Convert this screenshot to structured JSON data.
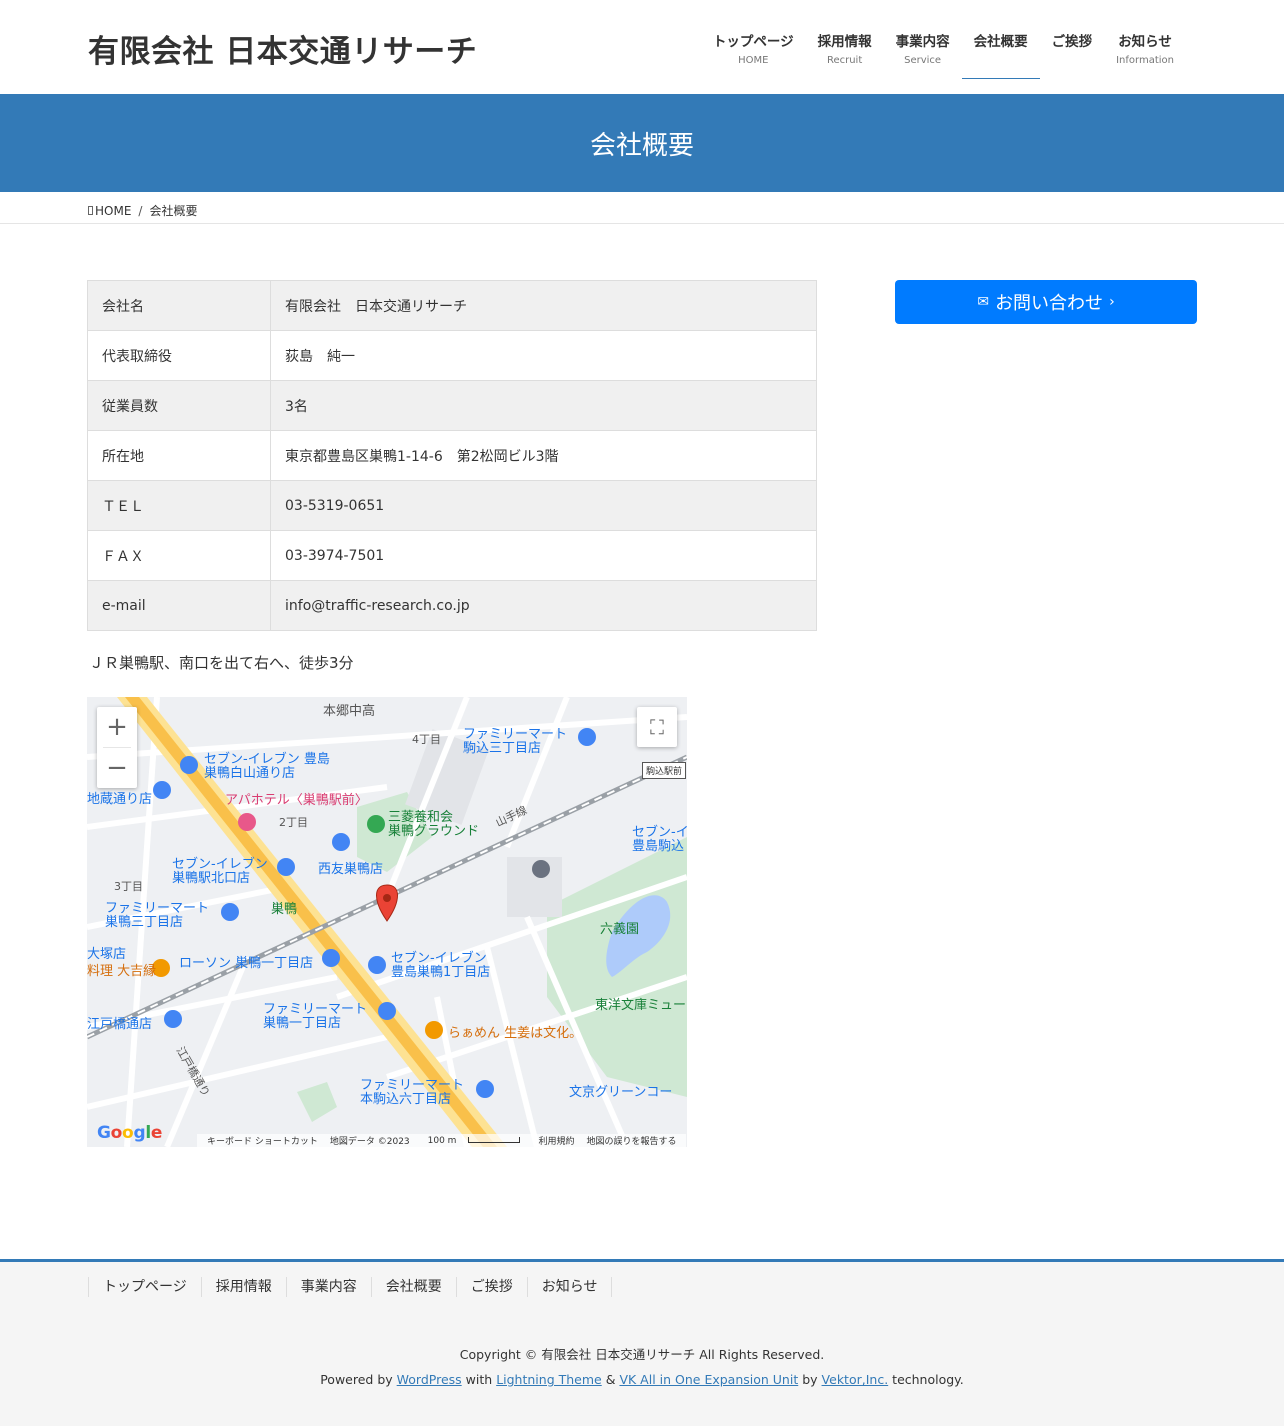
{
  "header": {
    "logo": "有限会社 日本交通リサーチ",
    "nav": [
      {
        "jp": "トップページ",
        "en": "HOME"
      },
      {
        "jp": "採用情報",
        "en": "Recruit"
      },
      {
        "jp": "事業内容",
        "en": "Service"
      },
      {
        "jp": "会社概要",
        "en": ""
      },
      {
        "jp": "ご挨拶",
        "en": ""
      },
      {
        "jp": "お知らせ",
        "en": "Information"
      }
    ]
  },
  "page_title": "会社概要",
  "breadcrumb": {
    "home": "HOME",
    "current": "会社概要"
  },
  "company": {
    "rows": [
      {
        "label": "会社名",
        "value": "有限会社　日本交通リサーチ"
      },
      {
        "label": "代表取締役",
        "value": "荻島　純一"
      },
      {
        "label": "従業員数",
        "value": "3名"
      },
      {
        "label": "所在地",
        "value": "東京都豊島区巣鴨1-14-6　第2松岡ビル3階"
      },
      {
        "label": "ＴＥＬ",
        "value": "03-5319-0651"
      },
      {
        "label": "ＦＡＸ",
        "value": "03-3974-7501"
      },
      {
        "label": "e-mail",
        "value": "info@traffic-research.co.jp"
      }
    ]
  },
  "access_note": "ＪＲ巣鴨駅、南口を出て右へ、徒歩3分",
  "map": {
    "labels": {
      "hongo_jh": "本郷中高",
      "chome4": "4丁目",
      "fm_komagome3": "ファミリーマート\n駒込三丁目店",
      "seven_hakusan": "セブン-イレブン 豊島\n巣鴨白山通り店",
      "jizo": "地蔵通り店",
      "apa": "アパホテル〈巣鴨駅前〉",
      "chome2": "2丁目",
      "mitsubishi": "三菱養和会\n巣鴨グラウンド",
      "yamanote": "山手線",
      "seven_komagome": "セブン-イ\n豊島駒込",
      "seven_kitaguchi": "セブン-イレブン\n巣鴨駅北口店",
      "seiyu": "西友巣鴨店",
      "chome3": "3丁目",
      "fm_sugamo3": "ファミリーマート\n巣鴨三丁目店",
      "sugamo_station": "巣鴨",
      "rikugien": "六義園",
      "otsuka": "大塚店",
      "ryori": "料理 大吉縁",
      "lawson": "ローソン 巣鴨一丁目店",
      "seven_sugamo1": "セブン-イレブン\n豊島巣鴨1丁目店",
      "edobashi_store": "江戸橋通店",
      "fm_sugamo1": "ファミリーマート\n巣鴨一丁目店",
      "ramen": "らぁめん 生姜は文化。",
      "toyo_bunko": "東洋文庫ミュー",
      "edobashi_st": "江戸橋通り",
      "fm_honkomagome6": "ファミリーマート\n本駒込六丁目店",
      "bunkyo_green": "文京グリーンコー",
      "komagome_eki": "駒込駅前"
    },
    "google": "Google",
    "footer": {
      "shortcuts": "キーボード ショートカット",
      "mapdata": "地図データ ©2023",
      "scale": "100 m",
      "terms": "利用規約",
      "report": "地図の誤りを報告する"
    }
  },
  "sidebar": {
    "contact_button": "お問い合わせ"
  },
  "footer": {
    "nav": [
      "トップページ",
      "採用情報",
      "事業内容",
      "会社概要",
      "ご挨拶",
      "お知らせ"
    ],
    "copyright": "Copyright © 有限会社 日本交通リサーチ All Rights Reserved.",
    "powered": {
      "prefix": "Powered by",
      "wordpress": "WordPress",
      "with": "with",
      "lightning": "Lightning Theme",
      "amp": "&",
      "vk": "VK All in One Expansion Unit",
      "by": "by",
      "vektor": "Vektor,Inc.",
      "suffix": "technology."
    }
  }
}
